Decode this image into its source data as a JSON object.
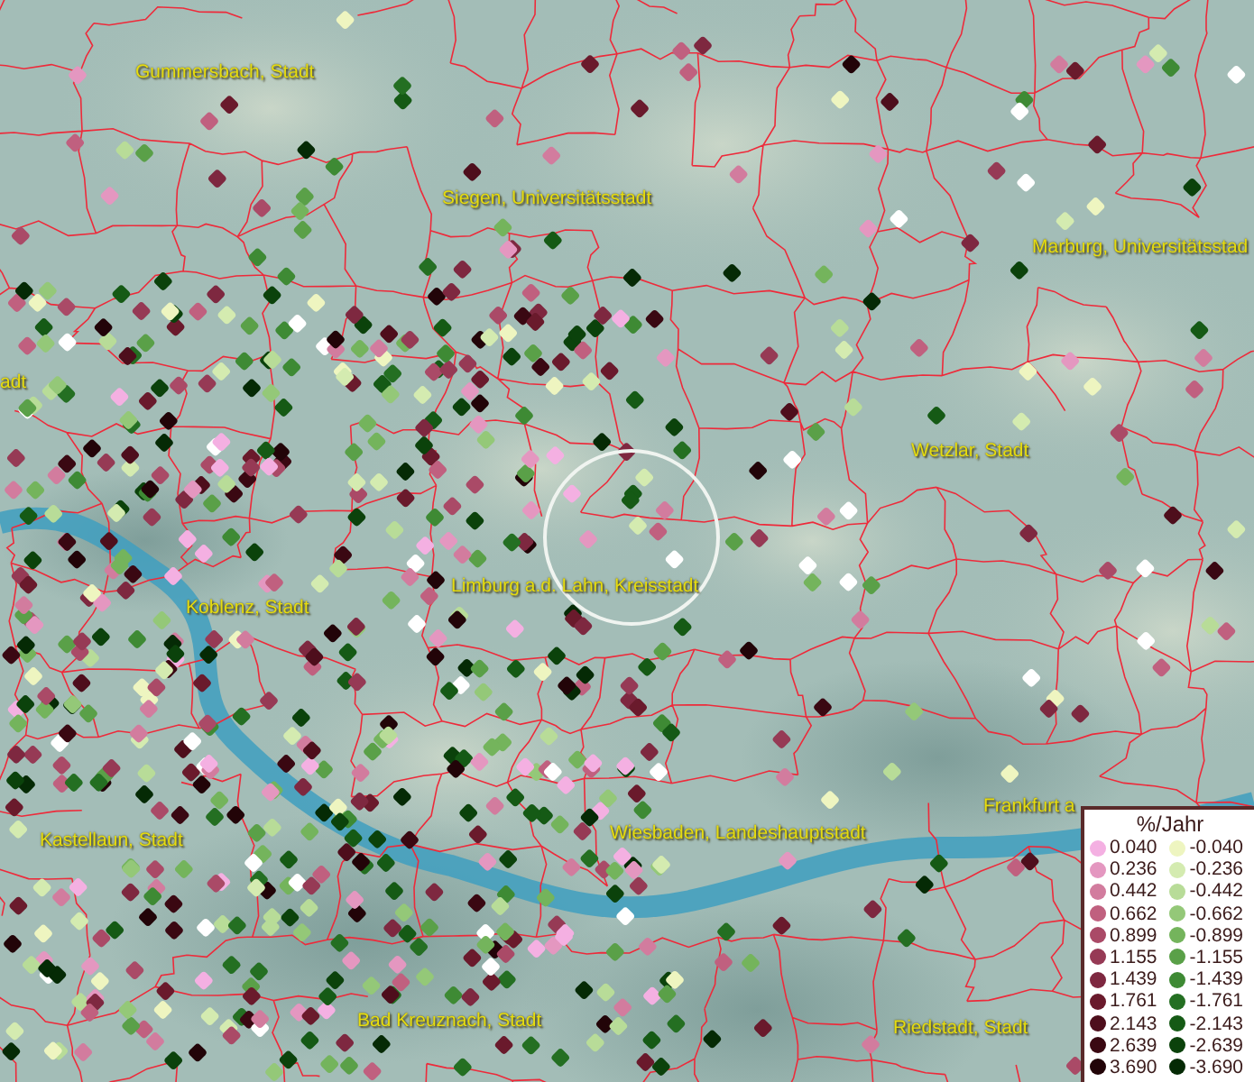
{
  "map": {
    "places": [
      {
        "label": "Gummersbach, Stadt"
      },
      {
        "label": "Siegen, Universitätsstadt"
      },
      {
        "label": "Marburg, Universitätsstad"
      },
      {
        "label": "adt"
      },
      {
        "label": "Wetzlar, Stadt"
      },
      {
        "label": "Limburg a.d. Lahn, Kreisstadt"
      },
      {
        "label": "Koblenz, Stadt"
      },
      {
        "label": "Frankfurt a"
      },
      {
        "label": "Kastellaun, Stadt"
      },
      {
        "label": "Wiesbaden, Landeshauptstadt"
      },
      {
        "label": "Bad Kreuznach, Stadt"
      },
      {
        "label": "Riedstadt, Stadt"
      }
    ]
  },
  "legend": {
    "title": "%/Jahr",
    "positive": [
      {
        "label": "0.040",
        "color": "#f4b0e2"
      },
      {
        "label": "0.236",
        "color": "#e497c0"
      },
      {
        "label": "0.442",
        "color": "#d27c9e"
      },
      {
        "label": "0.662",
        "color": "#c0607f"
      },
      {
        "label": "0.899",
        "color": "#aa4a67"
      },
      {
        "label": "1.155",
        "color": "#963a55"
      },
      {
        "label": "1.439",
        "color": "#7e2840"
      },
      {
        "label": "1.761",
        "color": "#6a1a2c"
      },
      {
        "label": "2.143",
        "color": "#4e0e1c"
      },
      {
        "label": "2.639",
        "color": "#3a0812"
      },
      {
        "label": "3.690",
        "color": "#220408"
      }
    ],
    "negative": [
      {
        "label": "-0.040",
        "color": "#eef5c0"
      },
      {
        "label": "-0.236",
        "color": "#d4ebb0"
      },
      {
        "label": "-0.442",
        "color": "#b8dc98"
      },
      {
        "label": "-0.662",
        "color": "#94c878"
      },
      {
        "label": "-0.899",
        "color": "#74b45c"
      },
      {
        "label": "-1.155",
        "color": "#5aa048"
      },
      {
        "label": "-1.439",
        "color": "#3e8a34"
      },
      {
        "label": "-1.761",
        "color": "#246f22"
      },
      {
        "label": "-2.143",
        "color": "#155a15"
      },
      {
        "label": "-2.639",
        "color": "#0b420b"
      },
      {
        "label": "-3.690",
        "color": "#052a05"
      }
    ]
  }
}
